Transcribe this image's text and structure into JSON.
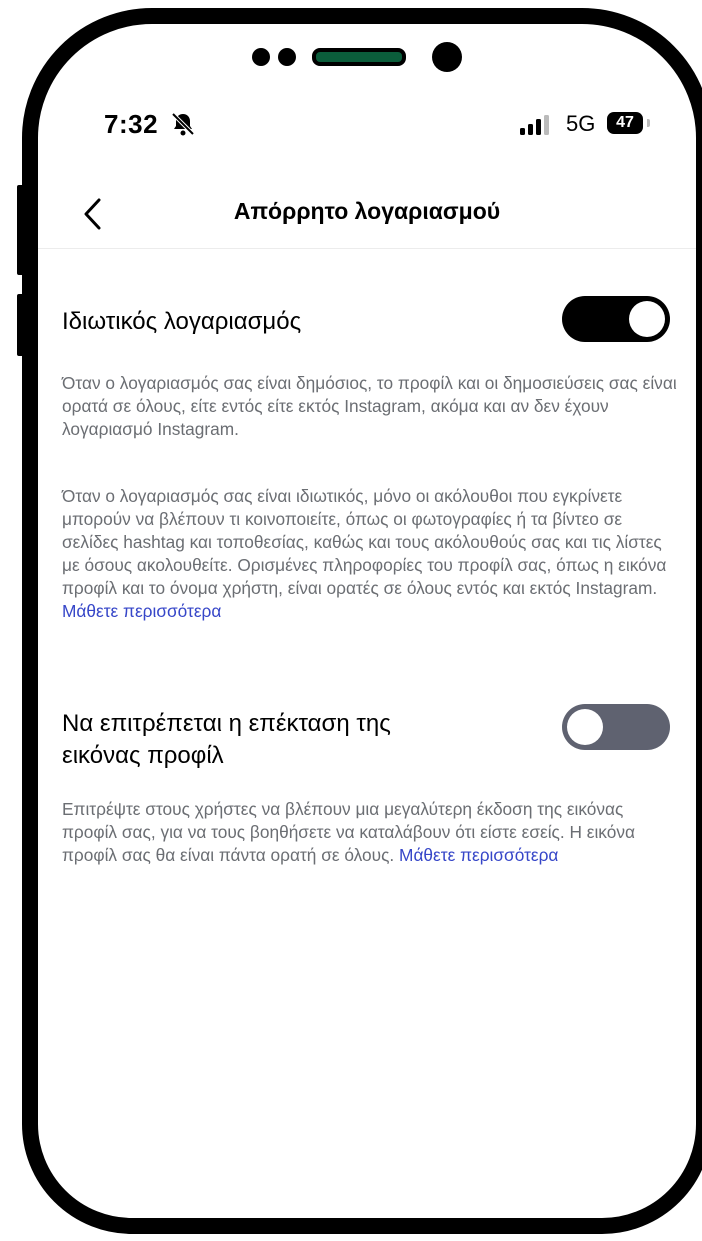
{
  "status_bar": {
    "time": "7:32",
    "network": "5G",
    "battery": "47",
    "icons": [
      "bell-muted-icon",
      "signal-bars-icon",
      "battery-icon"
    ]
  },
  "header": {
    "title": "Απόρρητο λογαριασμού",
    "back_icon": "chevron-left-icon"
  },
  "settings": [
    {
      "title": "Ιδιωτικός λογαριασμός",
      "enabled": true,
      "paragraphs": [
        {
          "text": "Όταν ο λογαριασμός σας είναι δημόσιος, το προφίλ και οι δημοσιεύσεις σας είναι ορατά σε όλους, είτε εντός είτε εκτός Instagram, ακόμα και αν δεν έχουν λογαριασμό Instagram."
        },
        {
          "text": "Όταν ο λογαριασμός σας είναι ιδιωτικός, μόνο οι ακόλουθοι που εγκρίνετε μπορούν να βλέπουν τι κοινοποιείτε, όπως οι φωτογραφίες ή τα βίντεο σε σελίδες hashtag και τοποθεσίας, καθώς και τους ακόλουθούς σας και τις λίστες με όσους ακολουθείτε. Ορισμένες πληροφορίες του προφίλ σας, όπως η εικόνα προφίλ και το όνομα χρήστη, είναι ορατές σε όλους εντός και εκτός Instagram.",
          "link": "Μάθετε περισσότερα"
        }
      ]
    },
    {
      "title_line1": "Να επιτρέπεται η επέκταση της",
      "title_line2": "εικόνας προφίλ",
      "enabled": false,
      "paragraphs": [
        {
          "text": "Επιτρέψτε στους χρήστες να βλέπουν μια μεγαλύτερη έκδοση της εικόνας προφίλ σας, για να τους βοηθήσετε να καταλάβουν ότι είστε εσείς. Η εικόνα προφίλ σας θα είναι πάντα ορατή σε όλους.",
          "link": "Μάθετε περισσότερα"
        }
      ]
    }
  ],
  "colors": {
    "link": "#3646c8",
    "toggle_on": "#000000",
    "toggle_off": "#5f6270",
    "description": "#6b6e73"
  }
}
